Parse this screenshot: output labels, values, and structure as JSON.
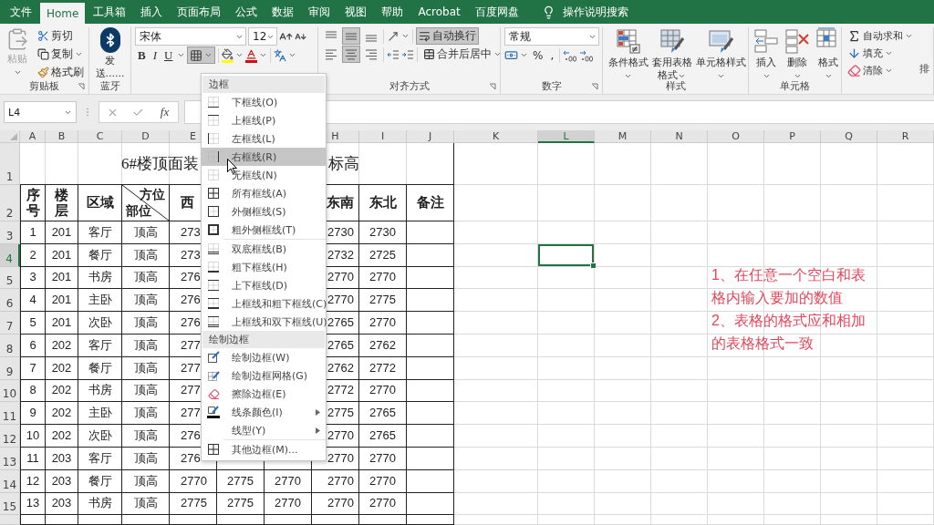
{
  "tabs": [
    {
      "label": "文件",
      "selected": false
    },
    {
      "label": "Home",
      "selected": true
    },
    {
      "label": "工具箱",
      "selected": false
    },
    {
      "label": "插入",
      "selected": false
    },
    {
      "label": "页面布局",
      "selected": false
    },
    {
      "label": "公式",
      "selected": false
    },
    {
      "label": "数据",
      "selected": false
    },
    {
      "label": "审阅",
      "selected": false
    },
    {
      "label": "视图",
      "selected": false
    },
    {
      "label": "帮助",
      "selected": false
    },
    {
      "label": "Acrobat",
      "selected": false
    },
    {
      "label": "百度网盘",
      "selected": false
    }
  ],
  "tell_me": "操作说明搜索",
  "ribbon": {
    "clipboard": {
      "paste": {
        "label": "粘贴",
        "disabled": true
      },
      "cut": "剪切",
      "copy": "复制",
      "format_painter": "格式刷",
      "label": "剪贴板"
    },
    "bluetooth": {
      "send": "发送......",
      "label": "蓝牙"
    },
    "font": {
      "name": "宋体",
      "size": "12",
      "bold": "B",
      "italic": "I",
      "underline": "U",
      "borders_open": true
    },
    "alignment": {
      "vertical": [
        {
          "kind": "top",
          "selected": false
        },
        {
          "kind": "middle",
          "selected": true
        },
        {
          "kind": "bottom",
          "selected": false
        }
      ],
      "horizontal": [
        {
          "kind": "left",
          "selected": false
        },
        {
          "kind": "center",
          "selected": true
        },
        {
          "kind": "right",
          "selected": false
        }
      ],
      "wrap_text": {
        "label": "自动换行",
        "on": true
      },
      "merge": "合并后居中",
      "label": "对齐方式"
    },
    "number": {
      "format": "常规",
      "percent": "%",
      "comma": ",",
      "label": "数字"
    },
    "styles": {
      "buttons": [
        {
          "kind": "conditional",
          "label": "条件格式"
        },
        {
          "kind": "table",
          "label": "套用表格格式"
        },
        {
          "kind": "cell",
          "label": "单元格样式"
        }
      ],
      "label": "样式"
    },
    "cells": {
      "buttons": [
        {
          "kind": "insert",
          "label": "插入"
        },
        {
          "kind": "delete",
          "label": "删除"
        },
        {
          "kind": "format",
          "label": "格式"
        }
      ],
      "label": "单元格"
    },
    "editing": {
      "items": [
        {
          "kind": "sum",
          "label": "自动求和"
        },
        {
          "kind": "fill",
          "label": "填充"
        },
        {
          "kind": "clear",
          "label": "清除"
        }
      ],
      "sort": "排"
    }
  },
  "formula_bar": {
    "name_box": "L4",
    "function_label": "fx"
  },
  "columns": [
    {
      "label": "A",
      "selected": false
    },
    {
      "label": "B",
      "selected": false
    },
    {
      "label": "C",
      "selected": false
    },
    {
      "label": "D",
      "selected": false
    },
    {
      "label": "E",
      "selected": false
    },
    {
      "label": "H",
      "selected": false
    },
    {
      "label": "I",
      "selected": false
    },
    {
      "label": "J",
      "selected": false
    },
    {
      "label": "K",
      "selected": false
    },
    {
      "label": "L",
      "selected": true
    },
    {
      "label": "M",
      "selected": false
    },
    {
      "label": "N",
      "selected": false
    },
    {
      "label": "O",
      "selected": false
    },
    {
      "label": "P",
      "selected": false
    },
    {
      "label": "Q",
      "selected": false
    },
    {
      "label": "R",
      "selected": false
    }
  ],
  "rows": [
    {
      "label": "1",
      "selected": false
    },
    {
      "label": "2",
      "selected": false
    },
    {
      "label": "3",
      "selected": false
    },
    {
      "label": "4",
      "selected": true
    },
    {
      "label": "5",
      "selected": false
    },
    {
      "label": "6",
      "selected": false
    },
    {
      "label": "7",
      "selected": false
    },
    {
      "label": "8",
      "selected": false
    },
    {
      "label": "9",
      "selected": false
    },
    {
      "label": "10",
      "selected": false
    },
    {
      "label": "11",
      "selected": false
    },
    {
      "label": "12",
      "selected": false
    },
    {
      "label": "13",
      "selected": false
    },
    {
      "label": "14",
      "selected": false
    },
    {
      "label": "15",
      "selected": false
    }
  ],
  "sheet": {
    "title": [
      "6#楼顶面装",
      "标高"
    ],
    "header": {
      "A": "序号",
      "B": "楼层",
      "C": "区域",
      "E": "西",
      "H": "东南",
      "I": "东北",
      "J": "备注"
    },
    "diagonal": {
      "top": "方位",
      "bottom": "部位"
    },
    "data": [
      {
        "A": "1",
        "B": "201",
        "C": "客厅",
        "D": "顶高",
        "E": "273",
        "H": "2730",
        "I": "2730"
      },
      {
        "A": "2",
        "B": "201",
        "C": "餐厅",
        "D": "顶高",
        "E": "273",
        "H": "2732",
        "I": "2725"
      },
      {
        "A": "3",
        "B": "201",
        "C": "书房",
        "D": "顶高",
        "E": "276",
        "H": "2770",
        "I": "2770"
      },
      {
        "A": "4",
        "B": "201",
        "C": "主卧",
        "D": "顶高",
        "E": "276",
        "H": "2770",
        "I": "2775"
      },
      {
        "A": "5",
        "B": "201",
        "C": "次卧",
        "D": "顶高",
        "E": "276",
        "H": "2765",
        "I": "2770"
      },
      {
        "A": "6",
        "B": "202",
        "C": "客厅",
        "D": "顶高",
        "E": "277",
        "H": "2765",
        "I": "2762"
      },
      {
        "A": "7",
        "B": "202",
        "C": "餐厅",
        "D": "顶高",
        "E": "277",
        "H": "2762",
        "I": "2772"
      },
      {
        "A": "8",
        "B": "202",
        "C": "书房",
        "D": "顶高",
        "E": "277",
        "H": "2772",
        "I": "2770"
      },
      {
        "A": "9",
        "B": "202",
        "C": "主卧",
        "D": "顶高",
        "E": "277",
        "H": "2775",
        "I": "2765"
      },
      {
        "A": "10",
        "B": "202",
        "C": "次卧",
        "D": "顶高",
        "E": "276",
        "H": "2770",
        "I": "2765"
      },
      {
        "A": "11",
        "B": "203",
        "C": "客厅",
        "D": "顶高",
        "E": "276",
        "H": "2770",
        "I": "2770"
      },
      {
        "A": "12",
        "B": "203",
        "C": "餐厅",
        "D": "顶高",
        "E": "2770",
        "F": "2775",
        "G": "2770",
        "H": "2770",
        "I": "2770"
      },
      {
        "A": "13",
        "B": "203",
        "C": "书房",
        "D": "顶高",
        "E": "2775",
        "F": "2775",
        "G": "2770",
        "H": "2770",
        "I": "2770"
      }
    ]
  },
  "note": [
    "1、在任意一个空白和表格内输入要加的数值",
    "2、表格的格式应和相加的表格格式一致"
  ],
  "border_menu": {
    "sections": [
      {
        "title": "边框",
        "groups": [
          [
            {
              "kind": "bottom",
              "label": "下框线(O)",
              "selected": false
            },
            {
              "kind": "top",
              "label": "上框线(P)",
              "selected": false
            },
            {
              "kind": "left",
              "label": "左框线(L)",
              "selected": false
            },
            {
              "kind": "right",
              "label": "右框线(R)",
              "selected": true
            },
            {
              "kind": "none",
              "label": "无框线(N)",
              "selected": false
            },
            {
              "kind": "all",
              "label": "所有框线(A)",
              "selected": false
            },
            {
              "kind": "outside",
              "label": "外侧框线(S)",
              "selected": false
            },
            {
              "kind": "thick_outside",
              "label": "粗外侧框线(T)",
              "selected": false
            }
          ],
          [
            {
              "kind": "double_bottom",
              "label": "双底框线(B)",
              "selected": false
            },
            {
              "kind": "thick_bottom",
              "label": "粗下框线(H)",
              "selected": false
            },
            {
              "kind": "top_bottom",
              "label": "上下框线(D)",
              "selected": false
            },
            {
              "kind": "top_thick_bottom",
              "label": "上框线和粗下框线(C)",
              "selected": false
            },
            {
              "kind": "top_double_bottom",
              "label": "上框线和双下框线(U)",
              "selected": false
            }
          ]
        ]
      },
      {
        "title": "绘制边框",
        "groups": [
          [
            {
              "kind": "draw",
              "label": "绘制边框(W)",
              "selected": false,
              "submenu": false
            },
            {
              "kind": "draw_grid",
              "label": "绘制边框网格(G)",
              "selected": false,
              "submenu": false
            },
            {
              "kind": "eraser",
              "label": "擦除边框(E)",
              "selected": false,
              "submenu": false
            },
            {
              "kind": "line_color",
              "label": "线条颜色(I)",
              "selected": false,
              "submenu": true
            },
            {
              "kind": "line_style",
              "label": "线型(Y)",
              "selected": false,
              "submenu": true
            }
          ],
          [
            {
              "kind": "more",
              "label": "其他边框(M)...",
              "selected": false,
              "submenu": false
            }
          ]
        ]
      }
    ]
  }
}
